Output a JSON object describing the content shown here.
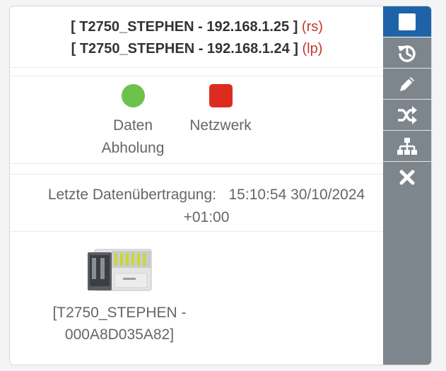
{
  "header": {
    "line1_name": "[ T2750_STEPHEN - 192.168.1.25 ]",
    "line1_tag": "(rs)",
    "line2_name": "[ T2750_STEPHEN - 192.168.1.24 ]",
    "line2_tag": "(lp)"
  },
  "statuses": [
    {
      "label": "Daten Abholung",
      "state": "green",
      "color": "#6cc24a"
    },
    {
      "label": "Netzwerk",
      "state": "red",
      "color": "#dd2c1f"
    }
  ],
  "last_transfer": {
    "label": "Letzte Datenübertragung:",
    "value": "15:10:54 30/10/2024 +01:00"
  },
  "device": {
    "name": "[T2750_STEPHEN - 000A8D035A82]"
  },
  "sidebar": {
    "items": [
      {
        "icon": "square-icon"
      },
      {
        "icon": "history-icon"
      },
      {
        "icon": "pencil-icon"
      },
      {
        "icon": "shuffle-icon"
      },
      {
        "icon": "sitemap-icon"
      },
      {
        "icon": "close-icon"
      }
    ],
    "background": "#7d858d",
    "active_color": "#1e63a8"
  }
}
